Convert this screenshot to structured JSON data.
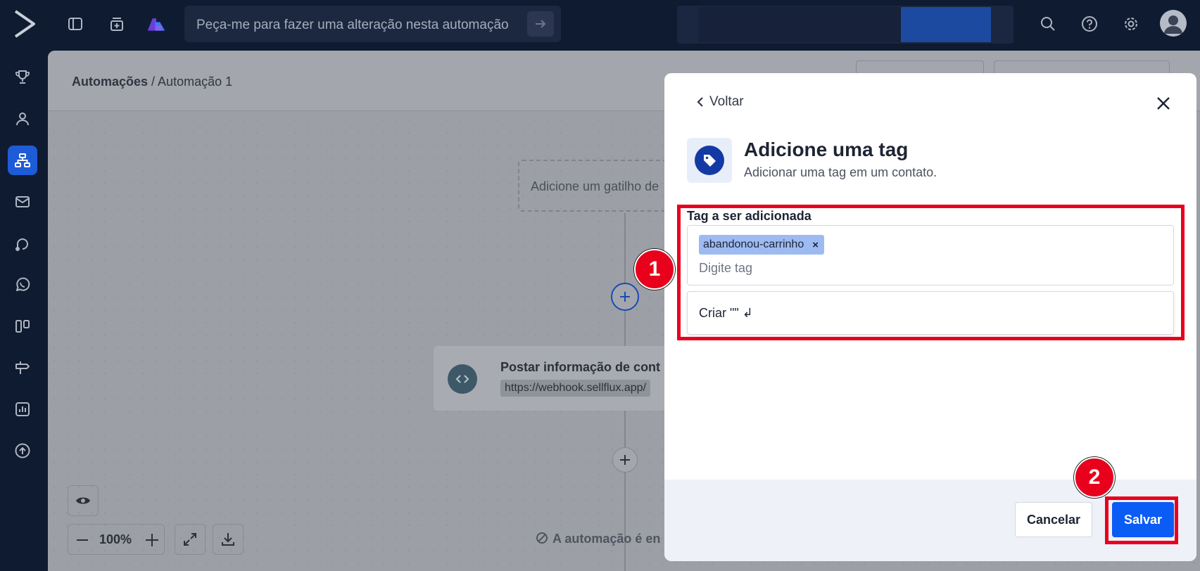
{
  "topbar": {
    "ai_placeholder": "Peça-me para fazer uma alteração nesta automação"
  },
  "sidebar": {
    "items": [
      "trophy-icon",
      "user-icon",
      "flow-icon",
      "mail-icon",
      "crm-icon",
      "whatsapp-icon",
      "board-icon",
      "signpost-icon",
      "report-icon",
      "upload-icon"
    ],
    "active_index": 2
  },
  "breadcrumb": {
    "root": "Automações",
    "separator": " / ",
    "current": "Automação 1"
  },
  "canvas": {
    "trigger_placeholder": "Adicione um gatilho de",
    "node_title": "Postar informação de cont",
    "node_url": "https://webhook.sellflux.app/",
    "zoom": "100%",
    "status_text": "A automação é en"
  },
  "modal": {
    "back_label": "Voltar",
    "title": "Adicione uma tag",
    "subtitle": "Adicionar uma tag em um contato.",
    "field_label": "Tag a ser adicionada",
    "selected_tags": [
      "abandonou-carrinho"
    ],
    "chip_remove": "×",
    "input_placeholder": "Digite tag",
    "input_value": "",
    "create_option": "Criar \"\" ↲",
    "cancel_label": "Cancelar",
    "save_label": "Salvar"
  },
  "annotations": {
    "step1": "1",
    "step2": "2",
    "color": "#e8001c"
  },
  "colors": {
    "primary": "#0a5cf4",
    "nav_bg": "#0f1b31",
    "tag_chip": "#9dbbf2"
  }
}
